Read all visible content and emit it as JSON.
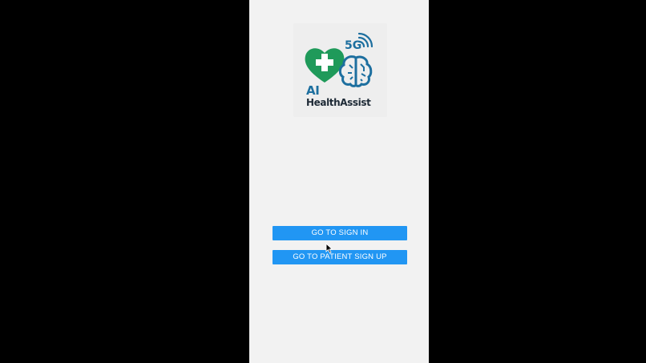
{
  "app": {
    "logo": {
      "line1": "AI",
      "line2": "HealthAssist",
      "badge": "5G",
      "colors": {
        "heart": "#1f9a5a",
        "brain": "#1d6f9f",
        "text_dark": "#1e2a36"
      },
      "icons": [
        "heart-cross-icon",
        "brain-circuit-icon",
        "wifi-signal-icon"
      ]
    },
    "buttons": {
      "sign_in": "GO TO SIGN IN",
      "patient_sign_up": "GO TO PATIENT SIGN UP"
    },
    "colors": {
      "button": "#2196f3",
      "screen_bg": "#f2f2f2",
      "outer_bg": "#000000"
    }
  }
}
